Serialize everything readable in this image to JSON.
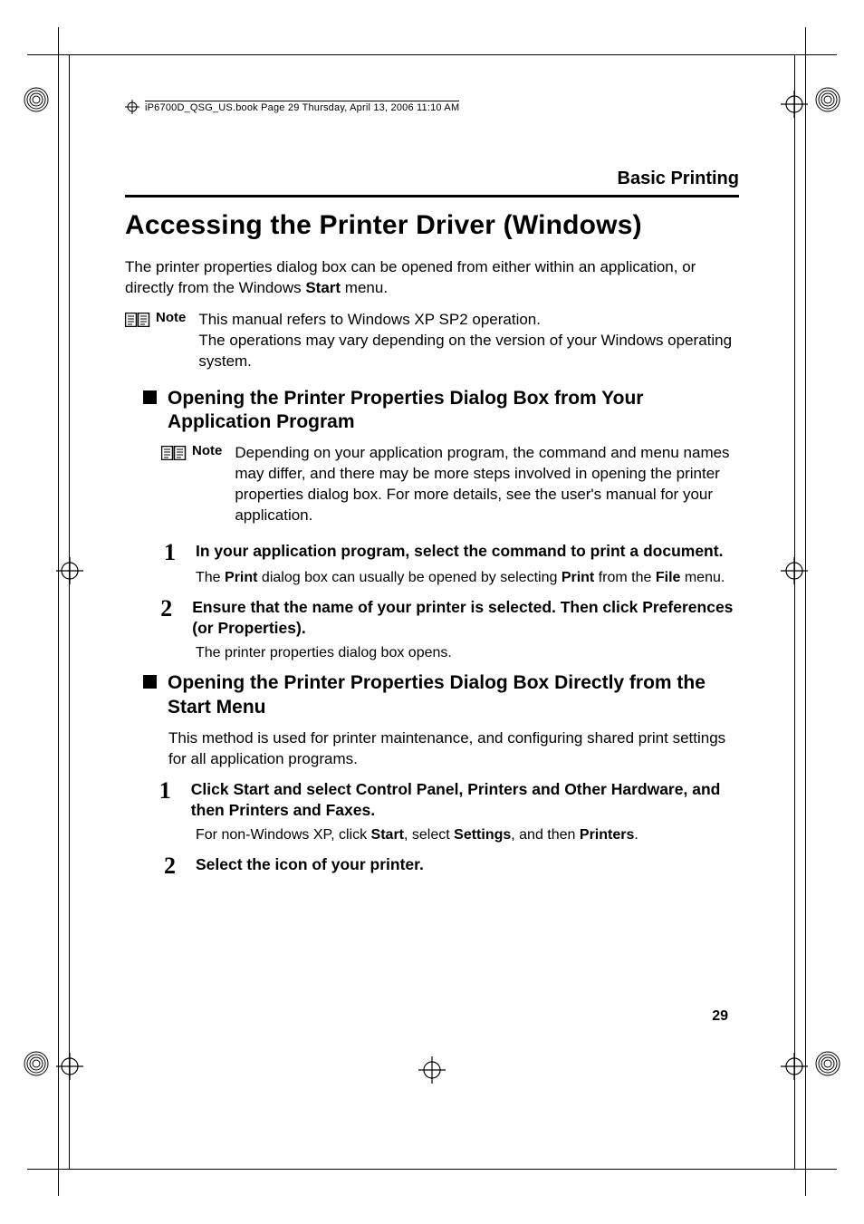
{
  "runhead": "iP6700D_QSG_US.book  Page 29  Thursday, April 13, 2006  11:10 AM",
  "section": "Basic Printing",
  "title": "Accessing the Printer Driver (Windows)",
  "intro_pre": "The printer properties dialog box can be opened from either within an application, or directly from the Windows ",
  "intro_bold": "Start",
  "intro_post": " menu.",
  "note1": {
    "label": "Note",
    "body": "This manual refers to Windows XP SP2 operation.\nThe operations may vary depending on the version of your Windows operating system."
  },
  "subA": {
    "heading": "Opening the Printer Properties Dialog Box from Your Application Program",
    "note": {
      "label": "Note",
      "body": "Depending on your application program, the command and menu names may differ, and there may be more steps involved in opening the printer properties dialog box. For more details, see the user's manual for your application."
    },
    "step1": {
      "text": "In your application program, select the command to print a document.",
      "sub_pre": "The ",
      "sub_b1": "Print",
      "sub_mid": " dialog box can usually be opened by selecting ",
      "sub_b2": "Print",
      "sub_mid2": " from the ",
      "sub_b3": "File",
      "sub_post": " menu."
    },
    "step2": {
      "pre": "Ensure that the name of your printer is selected. Then click ",
      "b1": "Preferences",
      "mid": " (or ",
      "b2": "Properties",
      "post": ").",
      "sub": "The printer properties dialog box opens."
    }
  },
  "subB": {
    "heading": "Opening the Printer Properties Dialog Box Directly from the Start Menu",
    "intro": "This method is used for printer maintenance, and configuring shared print settings for all application programs.",
    "step1": {
      "pre": "Click ",
      "b1": "Start",
      "mid1": " and select ",
      "b2": "Control Panel",
      "mid2": ", ",
      "b3": "Printers",
      "mid3": " and ",
      "b4": "Other Hardware",
      "mid4": ", and then ",
      "b5": "Printers and Faxes",
      "post": ".",
      "sub_pre": "For non-Windows XP, click ",
      "sub_b1": "Start",
      "sub_mid1": ", select ",
      "sub_b2": "Settings",
      "sub_mid2": ", and then ",
      "sub_b3": "Printers",
      "sub_post": "."
    },
    "step2": {
      "text": "Select the icon of your printer."
    }
  },
  "page_number": "29",
  "step_numbers": {
    "one": "1",
    "two": "2"
  }
}
